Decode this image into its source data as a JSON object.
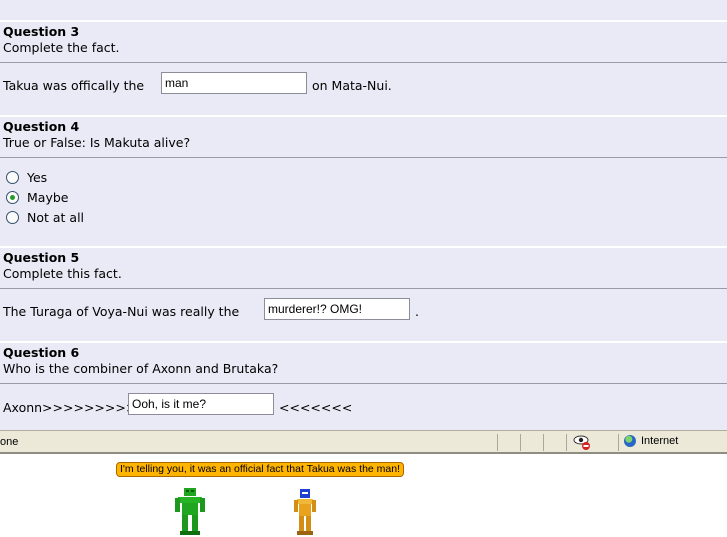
{
  "questions": [
    {
      "title": "Question 3",
      "instruction": "Complete the fact.",
      "before": "Takua was offically the",
      "answer": "man",
      "after": "on Mata-Nui."
    },
    {
      "title": "Question 4",
      "instruction": "True or False: Is Makuta alive?",
      "options": [
        "Yes",
        "Maybe",
        "Not at all"
      ],
      "selected": "Maybe"
    },
    {
      "title": "Question 5",
      "instruction": "Complete this fact.",
      "before": "The Turaga of Voya-Nui was really the",
      "answer": "murderer!? OMG!",
      "after": "."
    },
    {
      "title": "Question 6",
      "instruction": "Who is the combiner of Axonn and Brutaka?",
      "before": "Axonn>>>>>>>>>",
      "answer": "Ooh, is it me?",
      "after": "<<<<<<<"
    }
  ],
  "statusbar": {
    "text": "one",
    "zone": "Internet",
    "icons": [
      "privacy-eye-icon",
      "globe-icon"
    ]
  },
  "cartoon": {
    "speech": "I'm telling you, it was an official fact that Takua was the man!",
    "colors": {
      "left_figure": "#1fa51f",
      "right_figure": "#e8a21c",
      "mask": "#1f3fd0",
      "bubble": "#ffb400"
    }
  }
}
